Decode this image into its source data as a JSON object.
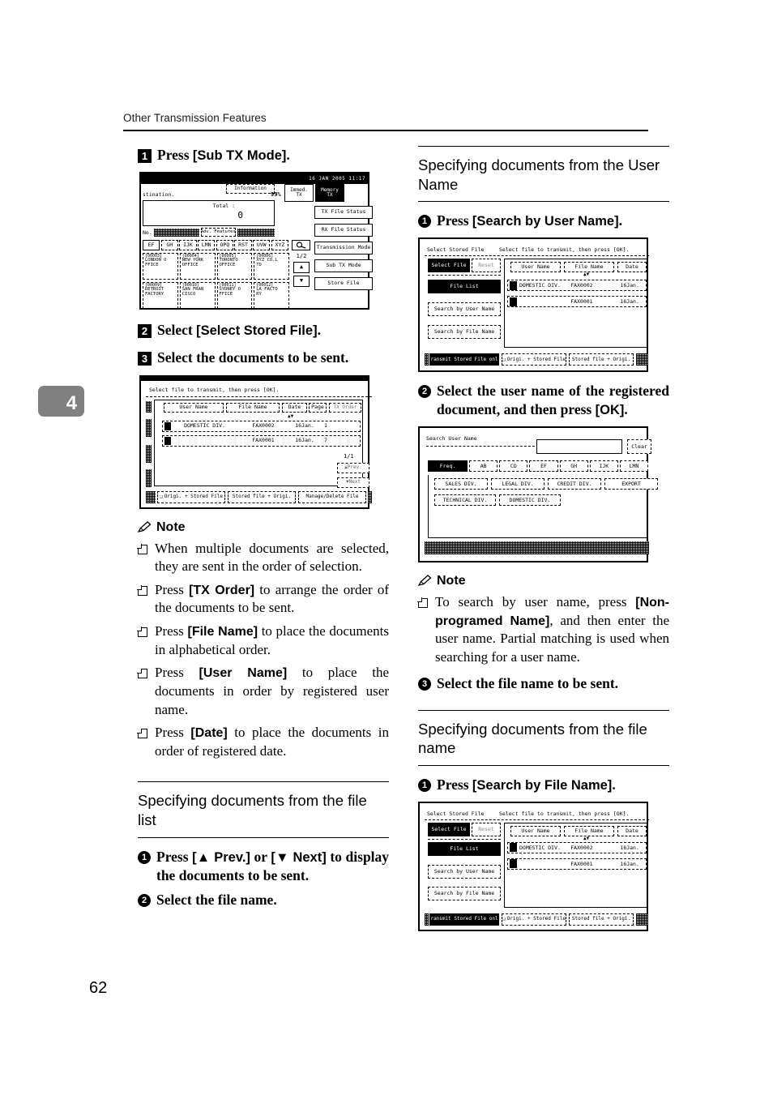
{
  "page": {
    "running_head": "Other Transmission Features",
    "chapter_tab": "4",
    "folio": "62"
  },
  "left_column": {
    "step1": {
      "num": "1",
      "text_pre": "Press ",
      "ui": "[Sub TX Mode]",
      "text_post": "."
    },
    "step2": {
      "num": "2",
      "text_pre": "Select ",
      "ui": "[Select Stored File]",
      "text_post": "."
    },
    "step3": {
      "num": "3",
      "text": "Select the documents to be sent."
    },
    "note_label": "Note",
    "notes": [
      {
        "full": "When multiple documents are selected, they are sent in the order of selection."
      },
      {
        "pre": "Press ",
        "ui": "[TX Order]",
        "post": " to arrange the order of the documents to be sent."
      },
      {
        "pre": "Press ",
        "ui": "[File Name]",
        "post": " to place the documents in alphabetical order."
      },
      {
        "pre": "Press ",
        "ui": "[User Name]",
        "post": " to place the documents in order by registered user name."
      },
      {
        "pre": "Press ",
        "ui": "[Date]",
        "post": " to place the documents in order of registered date."
      }
    ],
    "section_heading": "Specifying documents from the file list",
    "substep1": {
      "num": "1",
      "text": "Press [▲ Prev.] or [▼ Next] to display the documents to be sent."
    },
    "substep1_pre": "Press ",
    "substep1_ui_a": "[▲ Prev.]",
    "substep1_mid": " or ",
    "substep1_ui_b": "[▼ Next]",
    "substep1_post": " to display the documents to be sent.",
    "substep2": {
      "num": "2",
      "text": "Select the file name."
    }
  },
  "right_column": {
    "section_heading_1": "Specifying documents from the User Name",
    "step1": {
      "num": "1",
      "pre": "Press ",
      "ui": "[Search by User Name]",
      "post": "."
    },
    "step2": {
      "num": "2",
      "pre": "Select the user name of the registered document, and then press ",
      "ui": "[OK]",
      "post": "."
    },
    "note_label": "Note",
    "note1": {
      "pre": "To search by user name, press ",
      "ui": "[Non-programed Name]",
      "post": ", and then enter the user name. Partial matching is used when searching for a user name."
    },
    "step3": {
      "num": "3",
      "text": "Select the file name to be sent."
    },
    "section_heading_2": "Specifying documents from the file name",
    "step4": {
      "num": "1",
      "pre": "Press ",
      "ui": "[Search by File Name]",
      "post": "."
    }
  },
  "lcd_standby": {
    "status_bar": "16 JAN  2005 11:17",
    "destination_line": "stination.",
    "memory_pct": "99%",
    "information_button": "Information",
    "immediate_tx": [
      "Immed.",
      "TX"
    ],
    "memory_tx": [
      "Memory",
      "TX"
    ],
    "total_label": "Total :",
    "total_value": "0",
    "number_label": "No.",
    "adv_features": "Adv. Features",
    "letter_tabs": [
      "EF",
      "GH",
      "IJK",
      "LMN",
      "OPQ",
      "RST",
      "UVW",
      "XYZ"
    ],
    "search_icon": "search-icon",
    "page_indicator": "1/2",
    "dest_cells": [
      {
        "id": "[00003]",
        "line1": "LONDON O",
        "line2": "FFICE"
      },
      {
        "id": "[00004]",
        "line1": "NEW YORK",
        "line2": "OFFICE"
      },
      {
        "id": "[00005]",
        "line1": "TORONTO",
        "line2": "OFFICE"
      },
      {
        "id": "[00006]",
        "line1": "XYZ CO.L",
        "line2": "TD"
      },
      {
        "id": "[00009]",
        "line1": "DETROIT",
        "line2": "FACTORY"
      },
      {
        "id": "[00010]",
        "line1": "SAN FRAN",
        "line2": "CISCO"
      },
      {
        "id": "[00011]",
        "line1": "SYDNEY O",
        "line2": "FFICE"
      },
      {
        "id": "[00012]",
        "line1": "LA FACTO",
        "line2": "RY"
      }
    ],
    "right_buttons": [
      "TX File Status",
      "RX File Status",
      "Transmission Mode",
      "Sub TX Mode",
      "Store File"
    ]
  },
  "lcd_filelist": {
    "prompt": "Select file to transmit, then press [OK].",
    "columns": [
      "User Name",
      "File Name",
      "Date",
      "Page",
      "TX Order"
    ],
    "rows": [
      {
        "user": "DOMESTIC DIV.",
        "file": "FAX0002",
        "date": "16Jan.",
        "page": "1"
      },
      {
        "user": "",
        "file": "FAX0001",
        "date": "16Jan.",
        "page": "7"
      }
    ],
    "page_indicator": "1/1",
    "prev_button": "▲Prev.",
    "next_button": "▼Next",
    "bottom_buttons": [
      "Origi. + Stored File",
      "Stored file + Origi.",
      "Manage/Delete File"
    ]
  },
  "lcd_select_stored_file": {
    "title": "Select Stored File",
    "prompt": "Select file to transmit, then press [OK].",
    "tab_select_file": "Select File",
    "tab_reset": "Reset",
    "side_buttons": [
      "File List",
      "Search by User Name",
      "Search by File Name"
    ],
    "columns": [
      "User Name",
      "File Name",
      "Date"
    ],
    "rows": [
      {
        "user": "DOMESTIC DIV.",
        "file": "FAX0002",
        "date": "16Jan."
      },
      {
        "user": "",
        "file": "FAX0001",
        "date": "16Jan."
      }
    ],
    "bottom_buttons": [
      "Transmit Stored File only",
      "Origi. + Stored File",
      "Stored file + Origi."
    ]
  },
  "lcd_search_user": {
    "title": "Search User Name",
    "input_value": "",
    "clear_button": "Clear",
    "letter_tabs": [
      "Freq.",
      "AB",
      "CD",
      "EF",
      "GH",
      "IJK",
      "LMN"
    ],
    "names_row1": [
      "SALES DIV.",
      "LEGAL DIV.",
      "CREDIT DIV.",
      "EXPORT"
    ],
    "names_row2": [
      "TECHNICAL DIV.",
      "DOMESTIC DIV."
    ]
  }
}
